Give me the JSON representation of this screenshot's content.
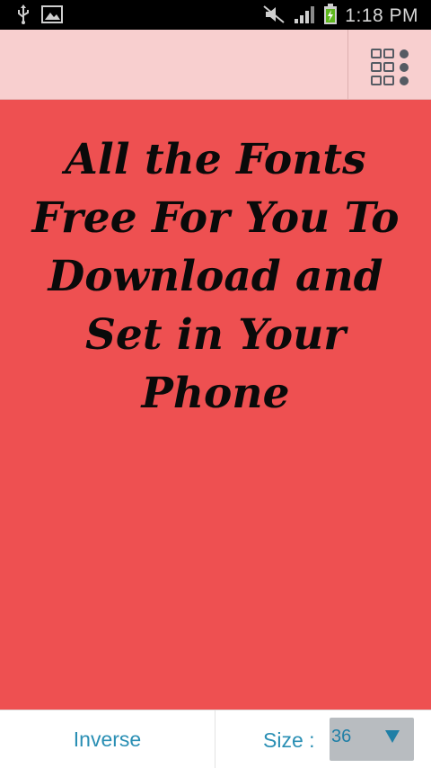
{
  "status_bar": {
    "time": "1:18 PM",
    "icons": [
      "usb-icon",
      "gallery-icon",
      "mute-icon",
      "signal-icon",
      "battery-charging-icon"
    ]
  },
  "toolbar": {
    "menu_icon": "grid-menu-icon"
  },
  "preview": {
    "text": "All the Fonts Free For You To Download and Set in Your Phone",
    "background": "#ee5051",
    "text_color": "#0a0a0a"
  },
  "bottom_bar": {
    "inverse_label": "Inverse",
    "size_label": "Size :",
    "size_value": "36",
    "accent": "#2a8fb4"
  }
}
